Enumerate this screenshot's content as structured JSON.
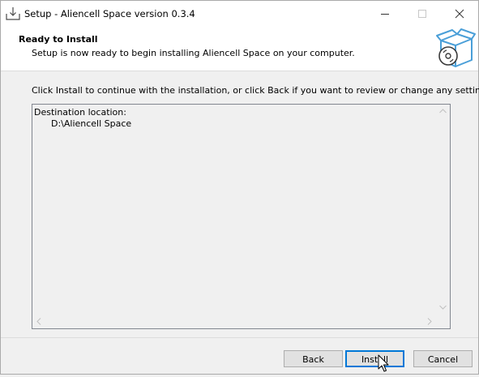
{
  "window": {
    "title": "Setup - Aliencell Space version 0.3.4"
  },
  "header": {
    "title": "Ready to Install",
    "subtitle": "Setup is now ready to begin installing Aliencell Space on your computer."
  },
  "main": {
    "instruction": "Click Install to continue with the installation, or click Back if you want to review or change any settings.",
    "memo_text": "Destination location:\n      D:\\Aliencell Space"
  },
  "buttons": {
    "back_label": "Back",
    "install_label": "Install",
    "cancel_label": "Cancel"
  },
  "colors": {
    "accent": "#0078d7",
    "dialog_bg": "#f0f0f0",
    "header_bg": "#ffffff",
    "logo_blue": "#4a9fd8"
  },
  "icons": {
    "app": "setup-download-icon",
    "logo": "software-box-cd-icon",
    "cursor": "mouse-pointer-icon"
  }
}
